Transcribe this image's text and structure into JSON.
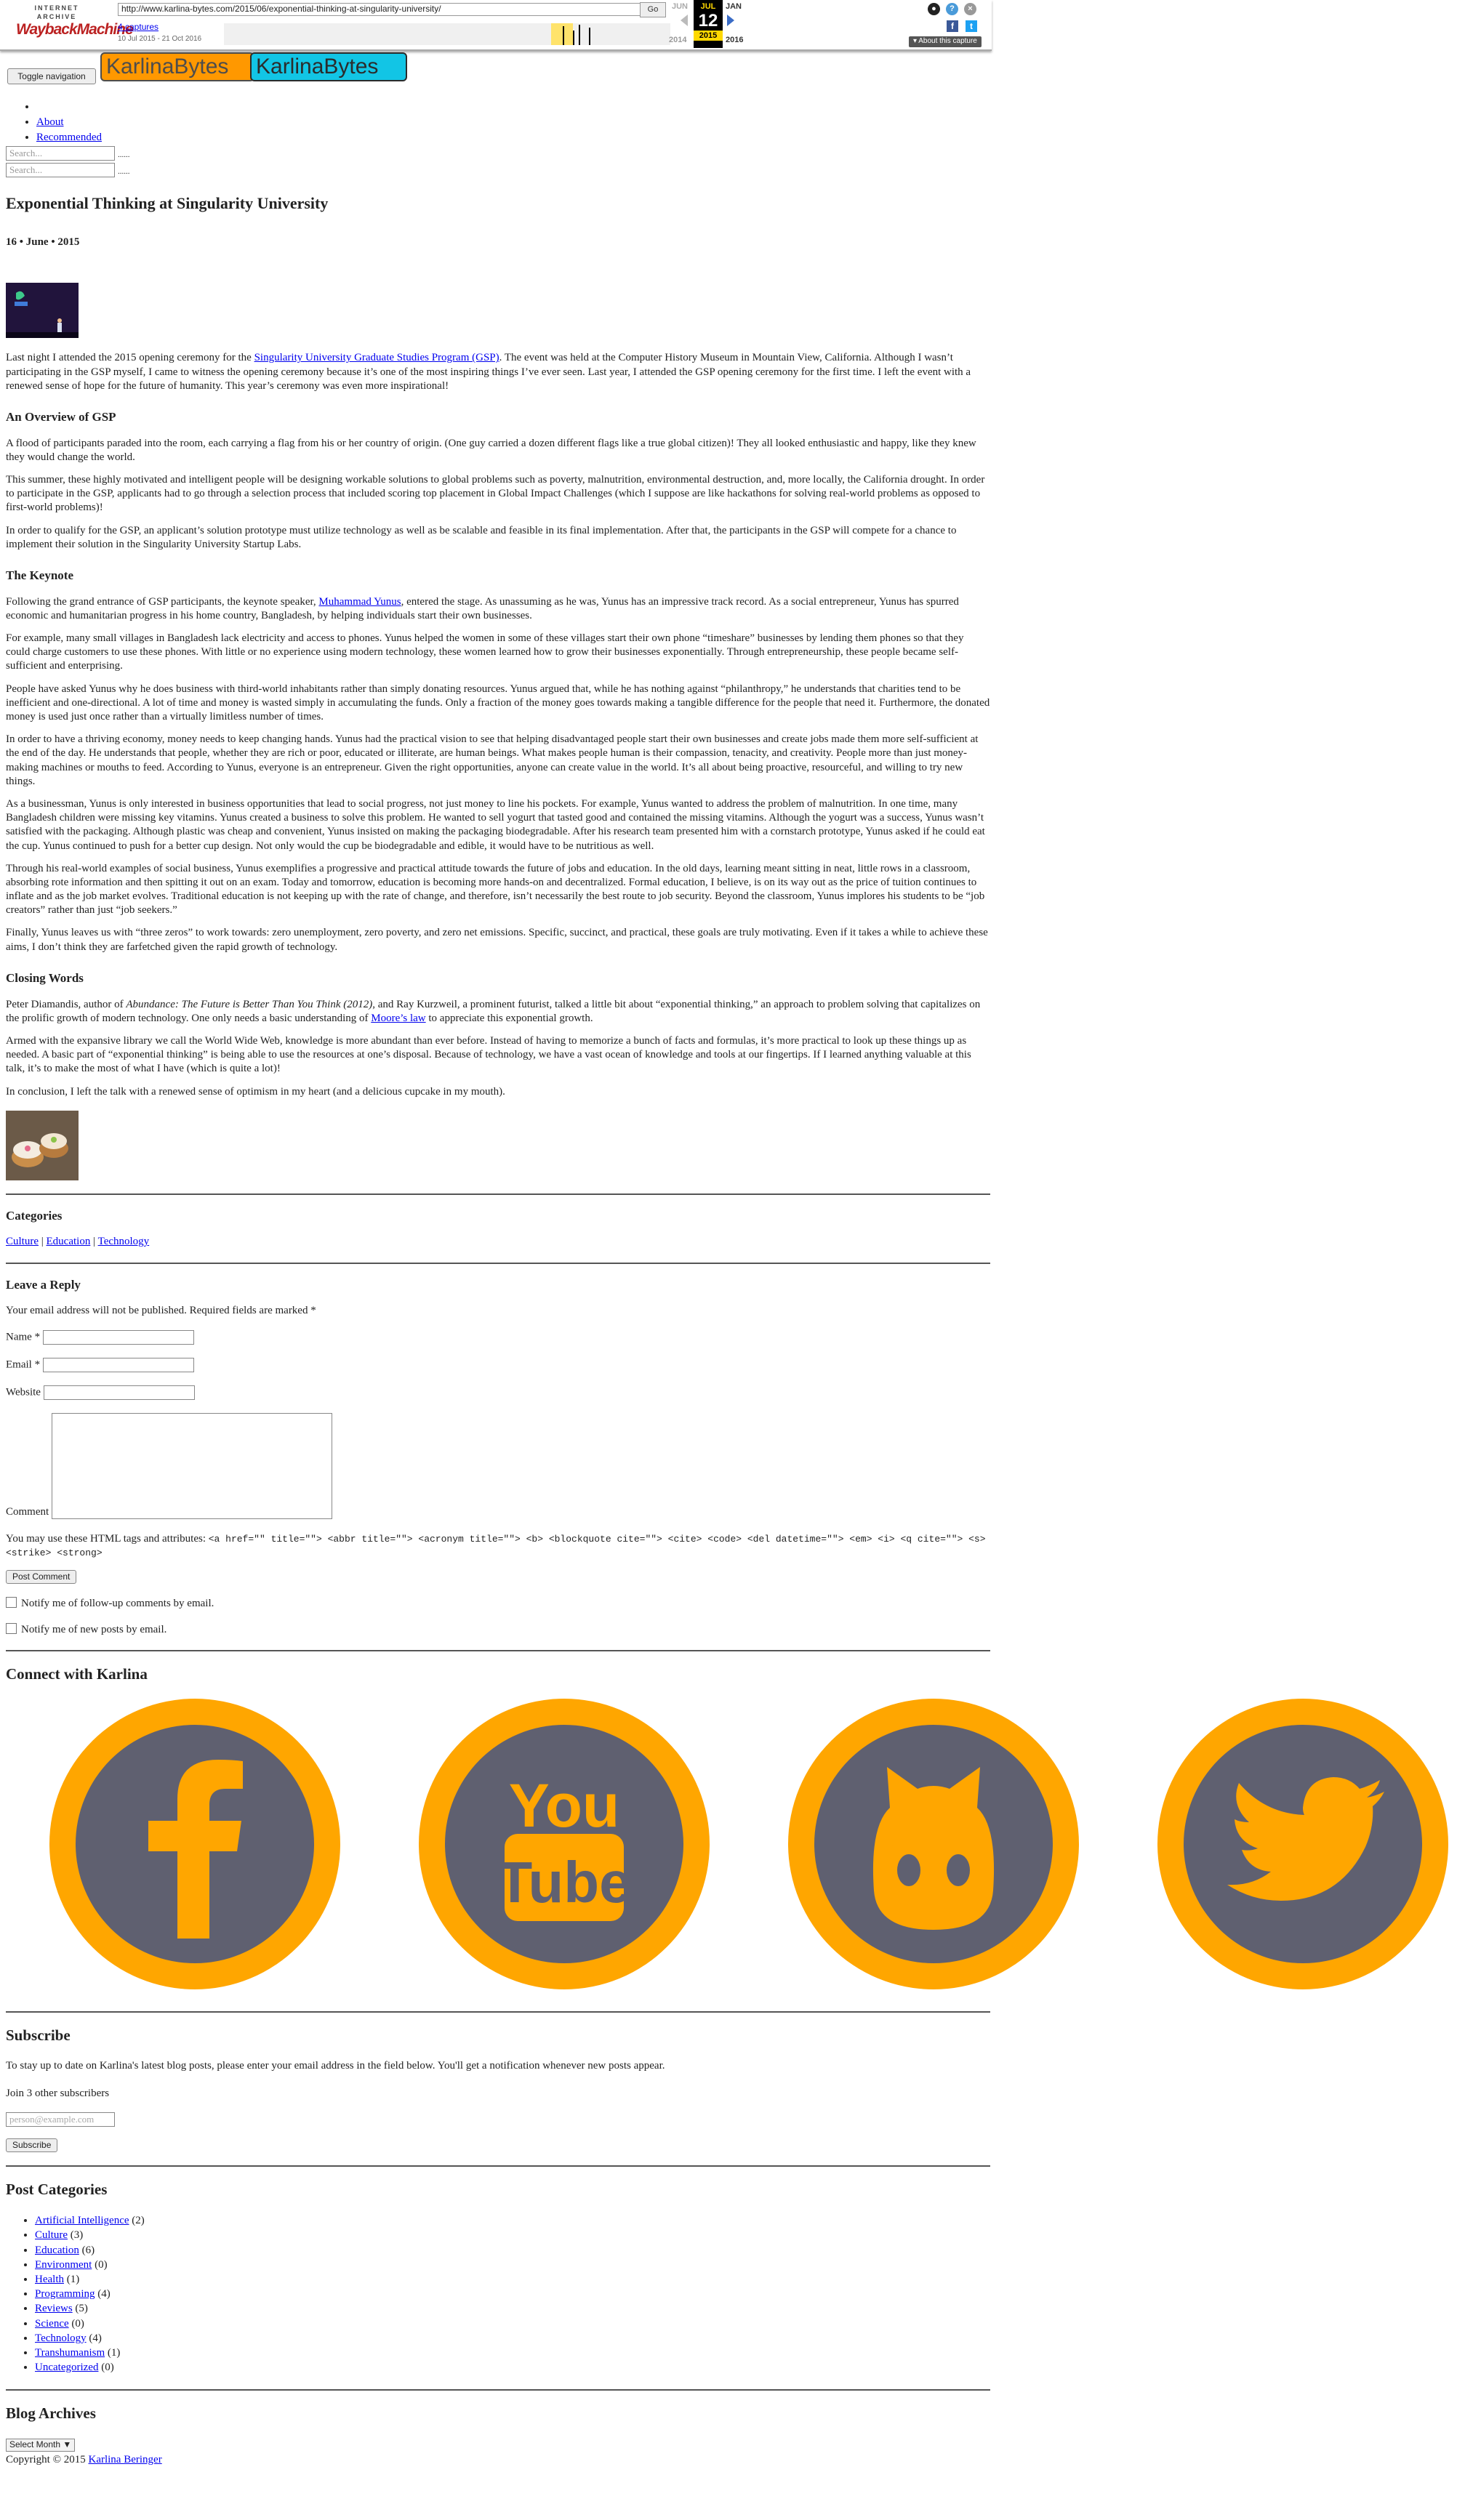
{
  "wayback": {
    "logo_top": "INTERNET ARCHIVE",
    "logo_main": "WaybackMachine",
    "url": "http://www.karlina-bytes.com/2015/06/exponential-thinking-at-singularity-university/",
    "go": "Go",
    "captures": "4 captures",
    "range": "10 Jul 2015 - 21 Oct 2016",
    "prev_month": "JUN",
    "cur_month": "JUL",
    "next_month": "JAN",
    "cur_day": "12",
    "prev_year": "2014",
    "cur_year": "2015",
    "next_year": "2016",
    "about": "About this capture"
  },
  "header": {
    "toggle": "Toggle navigation",
    "logo1": "KarlinaBytes",
    "logo2": "KarlinaBytes",
    "nav": [
      "About",
      "Recommended"
    ],
    "search_placeholder": "Search...",
    "search_dots": "......"
  },
  "post": {
    "title": "Exponential Thinking at Singularity University",
    "date": "16 • June • 2015",
    "p1_a": "Last night I attended the 2015 opening ceremony for the ",
    "p1_link": "Singularity University Graduate Studies Program (GSP)",
    "p1_b": ". The event was held at the Computer History Museum in Mountain View, California. Although I wasn’t participating in the GSP myself, I came to witness the opening ceremony because it’s one of the most inspiring things I’ve ever seen. Last year, I attended the GSP opening ceremony for the first time. I left the event with a renewed sense of hope for the future of humanity. This year’s ceremony was even more inspirational!",
    "h_overview": "An Overview of GSP",
    "p2": "A flood of participants paraded into the room, each carrying a flag from his or her country of origin. (One guy carried a dozen different flags like a true global citizen)! They all looked enthusiastic and happy, like they knew they would change the world.",
    "p3": "This summer, these highly motivated and intelligent people will be designing workable solutions to global problems such as poverty, malnutrition, environmental destruction, and, more locally, the California drought. In order to participate in the GSP, applicants had to go through a selection process that included scoring top placement in Global Impact Challenges (which I suppose are like hackathons for solving real-world problems as opposed to first-world problems)!",
    "p4": "In order to qualify for the GSP, an applicant’s solution prototype must utilize technology as well as be scalable and feasible in its final implementation. After that, the participants in the GSP will compete for a chance to implement their solution in the Singularity University Startup Labs.",
    "h_keynote": "The Keynote",
    "p5_a": "Following the grand entrance of GSP participants, the keynote speaker, ",
    "p5_link": "Muhammad Yunus",
    "p5_b": ", entered the stage. As unassuming as he was, Yunus has an impressive track record. As a social entrepreneur, Yunus has spurred economic and humanitarian progress in his home country, Bangladesh, by helping individuals start their own businesses.",
    "p6": "For example, many small villages in Bangladesh lack electricity and access to phones. Yunus helped the women in some of these villages start their own phone “timeshare” businesses by lending them phones so that they could charge customers to use these phones. With little or no experience using modern technology, these women learned how to grow their businesses exponentially. Through entrepreneurship, these people became self-sufficient and enterprising.",
    "p7": "People have asked Yunus why he does business with third-world inhabitants rather than simply donating resources. Yunus argued that, while he has nothing against “philanthropy,” he understands that charities tend to be inefficient and one-directional. A lot of time and money is wasted simply in accumulating the funds. Only a fraction of the money goes towards making a tangible difference for the people that need it. Furthermore, the donated money is used just once rather than a virtually limitless number of times.",
    "p8": "In order to have a thriving economy, money needs to keep changing hands. Yunus had the practical vision to see that helping disadvantaged people start their own businesses and create jobs made them more self-sufficient at the end of the day. He understands that people, whether they are rich or poor, educated or illiterate, are human beings. What makes people human is their compassion, tenacity, and creativity. People more than just money-making machines or mouths to feed. According to Yunus, everyone is an entrepreneur. Given the right opportunities, anyone can create value in the world. It’s all about being proactive, resourceful, and willing to try new things.",
    "p9": "As a businessman, Yunus is only interested in business opportunities that lead to social progress, not just money to line his pockets. For example, Yunus wanted to address the problem of malnutrition. In one time, many Bangladesh children were missing key vitamins. Yunus created a business to solve this problem. He wanted to sell yogurt that tasted good and contained the missing vitamins. Although the yogurt was a success, Yunus wasn’t satisfied with the packaging. Although plastic was cheap and convenient, Yunus insisted on making the packaging biodegradable. After his research team presented him with a cornstarch prototype, Yunus asked if he could eat the cup. Yunus continued to push for a better cup design. Not only would the cup be biodegradable and edible, it would have to be nutritious as well.",
    "p10": "Through his real-world examples of social business, Yunus exemplifies a progressive and practical attitude towards the future of jobs and education. In the old days, learning meant sitting in neat, little rows in a classroom, absorbing rote information and then spitting it out on an exam. Today and tomorrow, education is becoming more hands-on and decentralized. Formal education, I believe, is on its way out as the price of tuition continues to inflate and as the job market evolves. Traditional education is not keeping up with the rate of change, and therefore, isn’t necessarily the best route to job security. Beyond the classroom, Yunus implores his students to be “job creators” rather than just “job seekers.”",
    "p11": "Finally, Yunus leaves us with “three zeros” to work towards: zero unemployment, zero poverty, and zero net emissions. Specific, succinct, and practical, these goals are truly motivating. Even if it takes a while to achieve these aims, I don’t think they are farfetched given the rapid growth of technology.",
    "h_closing": "Closing Words",
    "p12_a": "Peter Diamandis, author of ",
    "p12_em": "Abundance: The Future is Better Than You Think (2012)",
    "p12_b": ", and Ray Kurzweil, a prominent futurist, talked a little bit about “exponential thinking,” an approach to problem solving that capitalizes on the prolific growth of modern technology. One only needs a basic understanding of ",
    "p12_link": "Moore’s law",
    "p12_c": " to appreciate this exponential growth.",
    "p13": "Armed with the expansive library we call the World Wide Web, knowledge is more abundant than ever before. Instead of having to memorize a bunch of facts and formulas, it’s more practical to look up these things up as needed. A basic part of “exponential thinking” is being able to use the resources at one’s disposal. Because of technology, we have a vast ocean of knowledge and tools at our fingertips. If I learned anything valuable at this talk, it’s to make the most of what I have (which is quite a lot)!",
    "p14": "In conclusion, I left the talk with a renewed sense of optimism in my heart (and a delicious cupcake in my mouth)."
  },
  "categories": {
    "heading": "Categories",
    "items": [
      "Culture",
      "Education",
      "Technology"
    ],
    "sep": " | "
  },
  "reply": {
    "heading": "Leave a Reply",
    "note": "Your email address will not be published. Required fields are marked *",
    "name": "Name *",
    "email": "Email *",
    "website": "Website",
    "comment": "Comment",
    "html_a": "You may use these ",
    "html_abbr": "HTML",
    "html_b": " tags and attributes: ",
    "html_tags": "<a href=\"\" title=\"\"> <abbr title=\"\"> <acronym title=\"\"> <b> <blockquote cite=\"\"> <cite> <code> <del datetime=\"\"> <em> <i> <q cite=\"\"> <s> <strike> <strong>",
    "post_btn": "Post Comment",
    "notify1": "Notify me of follow-up comments by email.",
    "notify2": "Notify me of new posts by email."
  },
  "connect": {
    "heading": "Connect with Karlina",
    "items": [
      {
        "name": "facebook-icon",
        "label": "f"
      },
      {
        "name": "youtube-icon",
        "label": "You Tube"
      },
      {
        "name": "github-icon",
        "label": ""
      },
      {
        "name": "twitter-icon",
        "label": ""
      }
    ],
    "ring_color": "#ffa600",
    "core_color": "#5f6070"
  },
  "subscribe": {
    "heading": "Subscribe",
    "text": "To stay up to date on Karlina's latest blog posts, please enter your email address in the field below. You'll get a notification whenever new posts appear.",
    "join": "Join 3 other subscribers",
    "placeholder": "person@example.com",
    "button": "Subscribe"
  },
  "post_categories": {
    "heading": "Post Categories",
    "items": [
      {
        "label": "Artificial Intelligence",
        "count": "(2)"
      },
      {
        "label": "Culture",
        "count": "(3)"
      },
      {
        "label": "Education",
        "count": "(6)"
      },
      {
        "label": "Environment",
        "count": "(0)"
      },
      {
        "label": "Health",
        "count": "(1)"
      },
      {
        "label": "Programming",
        "count": "(4)"
      },
      {
        "label": "Reviews",
        "count": "(5)"
      },
      {
        "label": "Science",
        "count": "(0)"
      },
      {
        "label": "Technology",
        "count": "(4)"
      },
      {
        "label": "Transhumanism",
        "count": "(1)"
      },
      {
        "label": "Uncategorized",
        "count": "(0)"
      }
    ]
  },
  "archives": {
    "heading": "Blog Archives",
    "select": "Select Month ▼"
  },
  "footer": {
    "copy": "Copyright © 2015 ",
    "author": "Karlina Beringer"
  }
}
